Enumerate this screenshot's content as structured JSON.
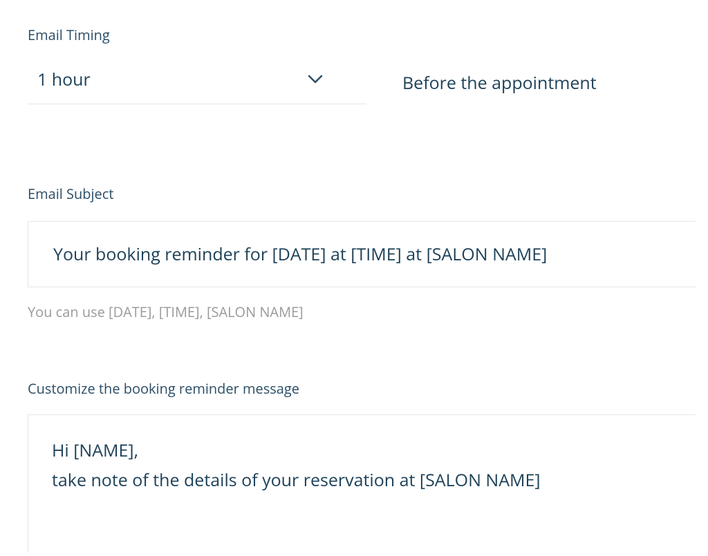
{
  "timing": {
    "label": "Email Timing",
    "value": "1 hour",
    "suffix": "Before the appointment"
  },
  "subject": {
    "label": "Email Subject",
    "value": "Your booking reminder for [DATE] at [TIME] at [SALON NAME]",
    "helper": "You can use [DATE], [TIME], [SALON NAME]"
  },
  "message": {
    "label": "Customize the booking reminder message",
    "value": "Hi [NAME],\ntake note of the details of your reservation at [SALON NAME]"
  }
}
